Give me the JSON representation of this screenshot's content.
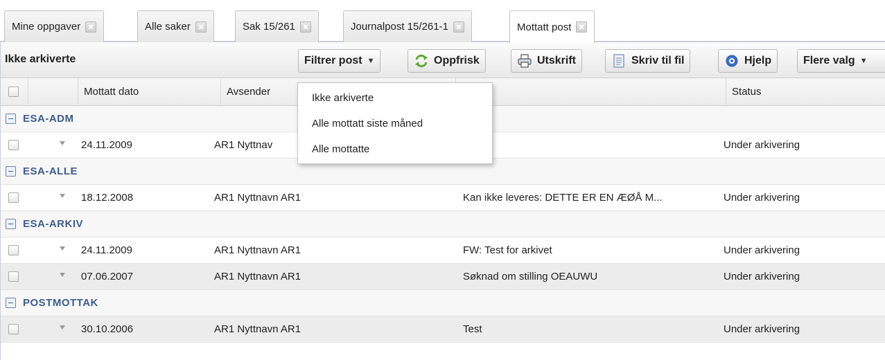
{
  "tabs": [
    {
      "label": "Mine oppgaver"
    },
    {
      "label": "Alle saker"
    },
    {
      "label": "Sak 15/261"
    },
    {
      "label": "Journalpost 15/261-1"
    },
    {
      "label": "Mottatt post"
    }
  ],
  "active_tab_index": 4,
  "toolbar": {
    "title": "Ikke arkiverte",
    "filter_label": "Filtrer post",
    "refresh_label": "Oppfrisk",
    "print_label": "Utskrift",
    "write_file_label": "Skriv til fil",
    "help_label": "Hjelp",
    "more_label": "Flere valg"
  },
  "filter_menu": {
    "items": [
      "Ikke arkiverte",
      "Alle mottatt siste måned",
      "Alle mottatte"
    ]
  },
  "grid": {
    "columns": {
      "date": "Mottatt dato",
      "sender": "Avsender",
      "status": "Status"
    },
    "groups": [
      {
        "name": "ESA-ADM",
        "rows": [
          {
            "date": "24.11.2009",
            "sender": "AR1 Nyttnav",
            "subject": "",
            "status": "Under arkivering"
          }
        ]
      },
      {
        "name": "ESA-ALLE",
        "rows": [
          {
            "date": "18.12.2008",
            "sender": "AR1 Nyttnavn AR1",
            "subject": "Kan ikke leveres: DETTE ER EN ÆØÅ M...",
            "status": "Under arkivering"
          }
        ]
      },
      {
        "name": "ESA-ARKIV",
        "rows": [
          {
            "date": "24.11.2009",
            "sender": "AR1 Nyttnavn AR1",
            "subject": "FW: Test for arkivet",
            "status": "Under arkivering"
          },
          {
            "date": "07.06.2007",
            "sender": "AR1 Nyttnavn AR1",
            "subject": "Søknad om stilling OEAUWU",
            "status": "Under arkivering"
          }
        ]
      },
      {
        "name": "POSTMOTTAK",
        "rows": [
          {
            "date": "30.10.2006",
            "sender": "AR1 Nyttnavn AR1",
            "subject": "Test",
            "status": "Under arkivering"
          }
        ]
      }
    ]
  },
  "colors": {
    "group_text": "#3d5c8e",
    "alt_row": "#ececec",
    "refresh_icon": "#5aa832",
    "help_icon": "#3a6fc4"
  },
  "icons": {
    "refresh": "refresh-icon",
    "print": "printer-icon",
    "write_file": "document-icon",
    "help": "help-icon"
  }
}
